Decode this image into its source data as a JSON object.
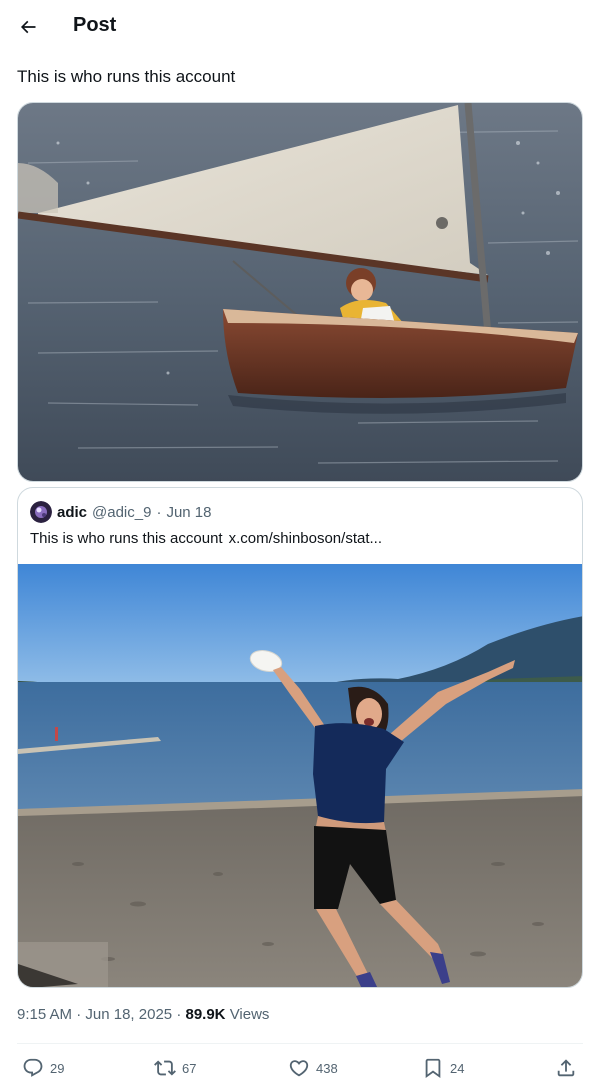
{
  "header": {
    "title": "Post"
  },
  "post": {
    "text": "This is who runs this account",
    "time": "9:15 AM",
    "date": "Jun 18, 2025",
    "separator": "·",
    "views_count": "89.9K",
    "views_label": "Views"
  },
  "quote": {
    "name": "adic",
    "handle": "@adic_9",
    "separator": "·",
    "date": "Jun 18",
    "text": "This is who runs this account",
    "link": "x.com/shinboson/stat..."
  },
  "actions": {
    "replies": "29",
    "reposts": "67",
    "likes": "438",
    "bookmarks": "24"
  },
  "icons": {
    "back": "arrow-left-icon",
    "reply": "speech-bubble-icon",
    "repost": "repost-arrows-icon",
    "like": "heart-icon",
    "bookmark": "bookmark-icon",
    "share": "share-upload-icon"
  },
  "colors": {
    "text_primary": "#0f1419",
    "text_secondary": "#536471",
    "border": "#cfd9de",
    "divider": "#eff3f4"
  }
}
